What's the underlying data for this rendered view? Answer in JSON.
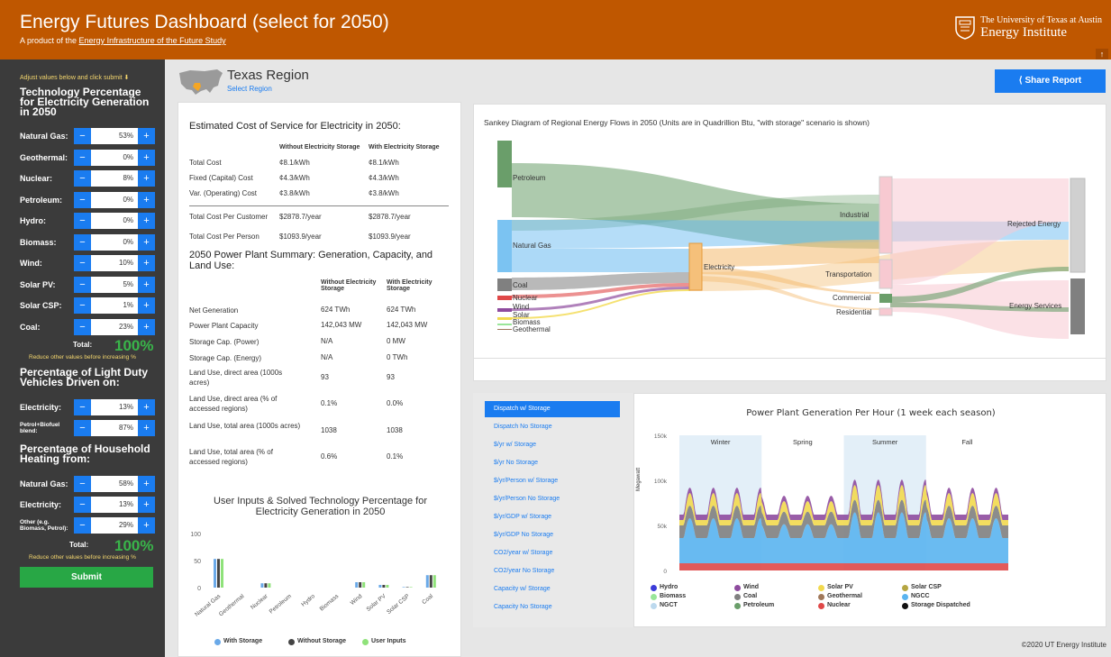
{
  "header": {
    "title": "Energy Futures Dashboard (select for 2050)",
    "subtitle_prefix": "A product of the ",
    "subtitle_link": "Energy Infrastructure of the Future Study",
    "org_line1": "The University of Texas at Austin",
    "org_line2": "Energy Institute",
    "brand_color": "#bf5700"
  },
  "sidebar": {
    "note": "Adjust values below and click submit ⬇",
    "tech_heading": "Technology Percentage for Electricity Generation in 2050",
    "tech": [
      {
        "label": "Natural Gas:",
        "value": "53%"
      },
      {
        "label": "Geothermal:",
        "value": "0%"
      },
      {
        "label": "Nuclear:",
        "value": "8%"
      },
      {
        "label": "Petroleum:",
        "value": "0%"
      },
      {
        "label": "Hydro:",
        "value": "0%"
      },
      {
        "label": "Biomass:",
        "value": "0%"
      },
      {
        "label": "Wind:",
        "value": "10%"
      },
      {
        "label": "Solar PV:",
        "value": "5%"
      },
      {
        "label": "Solar CSP:",
        "value": "1%"
      },
      {
        "label": "Coal:",
        "value": "23%"
      }
    ],
    "total_label": "Total:",
    "total_value": "100%",
    "warning": "Reduce other values before increasing %",
    "ldv_heading": "Percentage of Light Duty Vehicles Driven on:",
    "ldv": [
      {
        "label": "Electricity:",
        "value": "13%"
      },
      {
        "label": "Petrol+Biofuel blend:",
        "value": "87%"
      }
    ],
    "heat_heading": "Percentage of Household Heating from:",
    "heat": [
      {
        "label": "Natural Gas:",
        "value": "58%"
      },
      {
        "label": "Electricity:",
        "value": "13%"
      },
      {
        "label": "Other (e.g. Biomass, Petrol):",
        "value": "29%"
      }
    ],
    "total2_label": "Total:",
    "total2_value": "100%",
    "warning2": "Reduce other values before increasing %",
    "submit": "Submit"
  },
  "region": {
    "title": "Texas Region",
    "select": "Select Region"
  },
  "share": "Share Report",
  "cost": {
    "heading": "Estimated Cost of Service for Electricity in 2050:",
    "col1": "Without Electricity Storage",
    "col2": "With Electricity Storage",
    "rows": [
      {
        "label": "Total Cost",
        "a": "¢8.1/kWh",
        "b": "¢8.1/kWh"
      },
      {
        "label": "Fixed (Capital) Cost",
        "a": "¢4.3/kWh",
        "b": "¢4.3/kWh"
      },
      {
        "label": "Var. (Operating) Cost",
        "a": "¢3.8/kWh",
        "b": "¢3.8/kWh"
      }
    ],
    "per_customer": {
      "label": "Total Cost Per Customer",
      "a": "$2878.7/year",
      "b": "$2878.7/year"
    },
    "per_person": {
      "label": "Total Cost Per Person",
      "a": "$1093.9/year",
      "b": "$1093.9/year"
    }
  },
  "plant": {
    "heading": "2050 Power Plant Summary: Generation, Capacity, and Land Use:",
    "col1": "Without Electricity Storage",
    "col2": "With Electricity Storage",
    "rows": [
      {
        "label": "Net Generation",
        "a": "624 TWh",
        "b": "624 TWh"
      },
      {
        "label": "Power Plant Capacity",
        "a": "142,043 MW",
        "b": "142,043 MW"
      },
      {
        "label": "Storage Cap. (Power)",
        "a": "N/A",
        "b": "0 MW"
      },
      {
        "label": "Storage Cap. (Energy)",
        "a": "N/A",
        "b": "0 TWh"
      },
      {
        "label": "Land Use, direct area (1000s acres)",
        "a": "93",
        "b": "93"
      },
      {
        "label": "Land Use, direct area (% of accessed regions)",
        "a": "0.1%",
        "b": "0.0%"
      },
      {
        "label": "Land Use, total area (1000s acres)",
        "a": "1038",
        "b": "1038"
      },
      {
        "label": "Land Use, total area (% of accessed regions)",
        "a": "0.6%",
        "b": "0.1%"
      }
    ]
  },
  "sankey": {
    "title": "Sankey Diagram of Regional Energy Flows in 2050 (Units are in Quadrillion Btu, \"with storage\" scenario is shown)",
    "sources": [
      "Petroleum",
      "Natural Gas",
      "Coal",
      "Nuclear",
      "Wind",
      "Solar",
      "Biomass",
      "Geothermal"
    ],
    "middle": "Electricity",
    "sectors": [
      "Industrial",
      "Transportation",
      "Commercial",
      "Residential"
    ],
    "sinks": [
      "Rejected Energy",
      "Energy Services"
    ]
  },
  "tabs": [
    "Dispatch w/ Storage",
    "Dispatch No Storage",
    "$/yr w/ Storage",
    "$/yr No Storage",
    "$/yr/Person w/ Storage",
    "$/yr/Person No Storage",
    "$/yr/GDP w/ Storage",
    "$/yr/GDP No Storage",
    "CO2/year w/ Storage",
    "CO2/year No Storage",
    "Capacity w/ Storage",
    "Capacity No Storage"
  ],
  "chart_data": [
    {
      "type": "bar",
      "title": "User Inputs & Solved Technology Percentage for Electricity Generation in 2050",
      "categories": [
        "Natural Gas",
        "Geothermal",
        "Nuclear",
        "Petroleum",
        "Hydro",
        "Biomass",
        "Wind",
        "Solar PV",
        "Solar CSP",
        "Coal"
      ],
      "ylim": [
        0,
        100
      ],
      "yticks": [
        "0",
        "50",
        "100"
      ],
      "series": [
        {
          "name": "With Storage",
          "color": "#6aa9e8",
          "values": [
            53,
            0,
            8,
            0,
            0,
            0,
            10,
            5,
            1,
            23
          ]
        },
        {
          "name": "Without Storage",
          "color": "#444444",
          "values": [
            53,
            0,
            8,
            0,
            0,
            0,
            10,
            5,
            1,
            23
          ]
        },
        {
          "name": "User Inputs",
          "color": "#8fe27a",
          "values": [
            53,
            0,
            8,
            0,
            0,
            0,
            10,
            5,
            1,
            23
          ]
        }
      ]
    },
    {
      "type": "area",
      "title": "Power Plant Generation Per Hour (1 week each season)",
      "ylabel": "Megawatt",
      "yticks": [
        "0",
        "50k",
        "100k",
        "150k"
      ],
      "ylim": [
        0,
        150000
      ],
      "seasons": [
        "Winter",
        "Spring",
        "Summer",
        "Fall"
      ],
      "legend": [
        {
          "name": "Hydro",
          "color": "#3b3bd9"
        },
        {
          "name": "Wind",
          "color": "#8e4b9e"
        },
        {
          "name": "Solar PV",
          "color": "#f2d94e"
        },
        {
          "name": "Solar CSP",
          "color": "#b5a642"
        },
        {
          "name": "Biomass",
          "color": "#99e699"
        },
        {
          "name": "Coal",
          "color": "#808080"
        },
        {
          "name": "Geothermal",
          "color": "#a0785a"
        },
        {
          "name": "NGCC",
          "color": "#5ab4ef"
        },
        {
          "name": "NGCT",
          "color": "#bcd9ee"
        },
        {
          "name": "Petroleum",
          "color": "#6a9e6a"
        },
        {
          "name": "Nuclear",
          "color": "#e04848"
        },
        {
          "name": "Storage Dispatched",
          "color": "#111111"
        }
      ]
    }
  ],
  "footer": "©2020 UT Energy Institute"
}
